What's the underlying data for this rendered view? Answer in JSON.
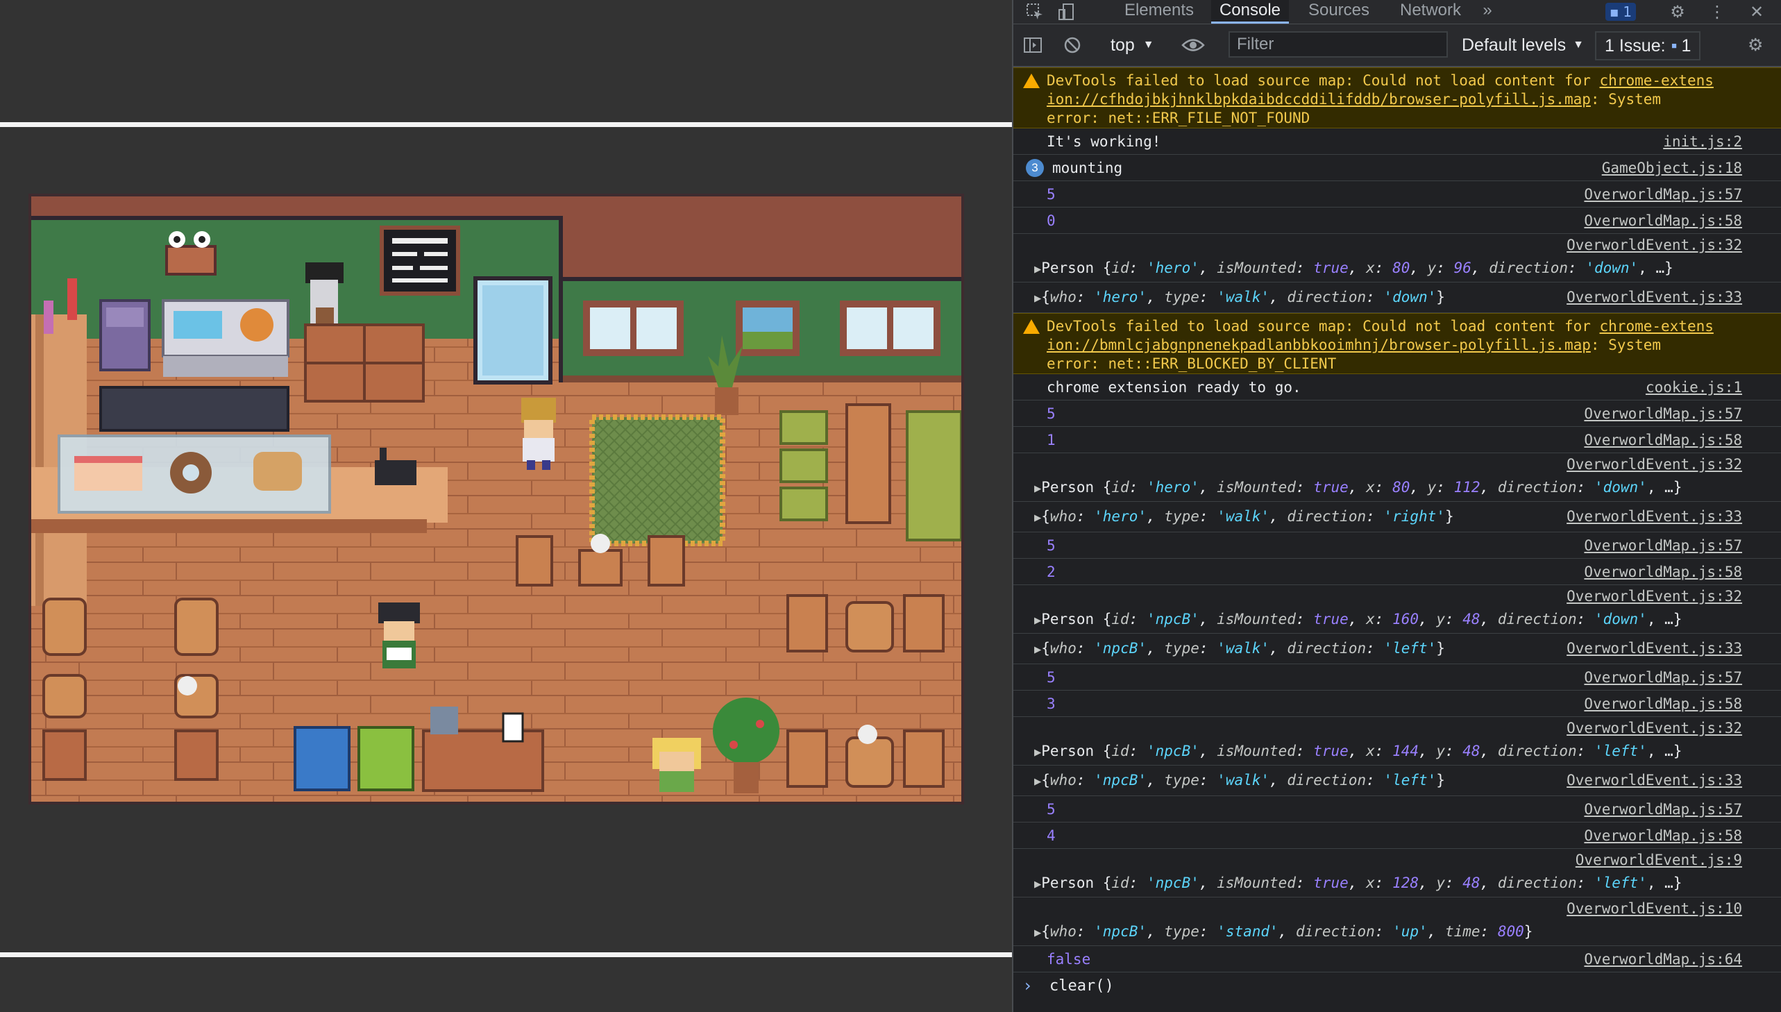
{
  "devtools": {
    "tabs": [
      "Elements",
      "Console",
      "Sources",
      "Network"
    ],
    "active_tab": "Console",
    "more_tabs": "»",
    "messages_badge": "1",
    "toolbar": {
      "context": "top",
      "filter_placeholder": "Filter",
      "levels": "Default levels",
      "issues_label": "1 Issue:",
      "issues_count": "1"
    },
    "console": {
      "warning1": {
        "line1_prefix": "DevTools failed to load source map: Could not load content for ",
        "line1_link": "chrome-extens",
        "line2_link": "ion://cfhdojbkjhnklbpkdaibdccddilifddb/browser-polyfill.js.map",
        "line2_suffix": ": System",
        "line3": "error: net::ERR_FILE_NOT_FOUND"
      },
      "log_working": {
        "text": "It's working!",
        "src": "init.js:2"
      },
      "log_mounting": {
        "count": "3",
        "text": "mounting",
        "src": "GameObject.js:18"
      },
      "n1": {
        "value": "5",
        "src": "OverworldMap.js:57"
      },
      "n2": {
        "value": "0",
        "src": "OverworldMap.js:58"
      },
      "p1": {
        "src": "OverworldEvent.js:32",
        "id": "'hero'",
        "mounted": "true",
        "x": "80",
        "y": "96",
        "dir": "'down'"
      },
      "e1": {
        "src": "OverworldEvent.js:33",
        "who": "'hero'",
        "type": "'walk'",
        "dir": "'down'"
      },
      "warning2": {
        "line1_prefix": "DevTools failed to load source map: Could not load content for ",
        "line1_link": "chrome-extens",
        "line2_link": "ion://bmnlcjabgnpnenekpadlanbbkooimhnj/browser-polyfill.js.map",
        "line2_suffix": ": System",
        "line3": "error: net::ERR_BLOCKED_BY_CLIENT"
      },
      "log_ext": {
        "text": "chrome extension ready to go.",
        "src": "cookie.js:1"
      },
      "n3": {
        "value": "5",
        "src": "OverworldMap.js:57"
      },
      "n4": {
        "value": "1",
        "src": "OverworldMap.js:58"
      },
      "p2": {
        "src": "OverworldEvent.js:32",
        "id": "'hero'",
        "mounted": "true",
        "x": "80",
        "y": "112",
        "dir": "'down'"
      },
      "e2": {
        "src": "OverworldEvent.js:33",
        "who": "'hero'",
        "type": "'walk'",
        "dir": "'right'"
      },
      "n5": {
        "value": "5",
        "src": "OverworldMap.js:57"
      },
      "n6": {
        "value": "2",
        "src": "OverworldMap.js:58"
      },
      "p3": {
        "src": "OverworldEvent.js:32",
        "id": "'npcB'",
        "mounted": "true",
        "x": "160",
        "y": "48",
        "dir": "'down'"
      },
      "e3": {
        "src": "OverworldEvent.js:33",
        "who": "'npcB'",
        "type": "'walk'",
        "dir": "'left'"
      },
      "n7": {
        "value": "5",
        "src": "OverworldMap.js:57"
      },
      "n8": {
        "value": "3",
        "src": "OverworldMap.js:58"
      },
      "p4": {
        "src": "OverworldEvent.js:32",
        "id": "'npcB'",
        "mounted": "true",
        "x": "144",
        "y": "48",
        "dir": "'left'"
      },
      "e4": {
        "src": "OverworldEvent.js:33",
        "who": "'npcB'",
        "type": "'walk'",
        "dir": "'left'"
      },
      "n9": {
        "value": "5",
        "src": "OverworldMap.js:57"
      },
      "n10": {
        "value": "4",
        "src": "OverworldMap.js:58"
      },
      "p5": {
        "src": "OverworldEvent.js:9",
        "id": "'npcB'",
        "mounted": "true",
        "x": "128",
        "y": "48",
        "dir": "'left'"
      },
      "e5": {
        "src": "OverworldEvent.js:10",
        "who": "'npcB'",
        "type": "'stand'",
        "dir": "'up'",
        "time": "800"
      },
      "log_false": {
        "value": "false",
        "src": "OverworldMap.js:64"
      },
      "prompt_text": "clear()"
    }
  },
  "colors": {
    "wall_green": "#3f7a48",
    "wall_brown": "#8e4f3f",
    "floor": "#c07a50",
    "floor_line": "#a8603f",
    "warning_bg": "#332b00",
    "warning_text": "#f2c94c",
    "number": "#9980ff",
    "string": "#5cd5fb"
  }
}
